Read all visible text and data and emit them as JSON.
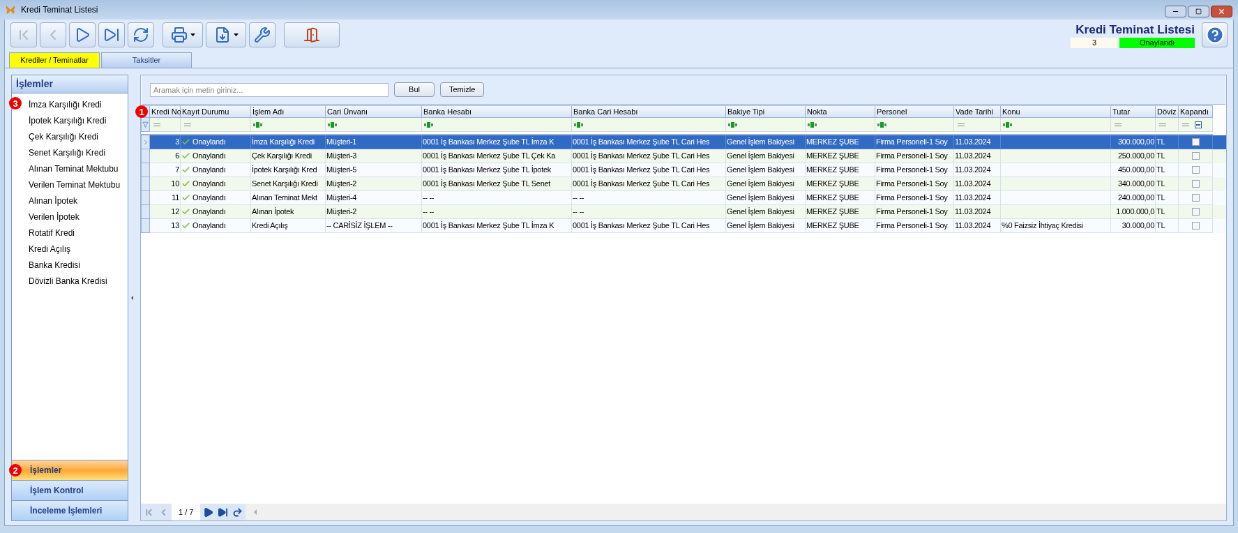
{
  "window": {
    "title": "Kredi Teminat Listesi"
  },
  "toolbar": [
    {
      "kind": "first",
      "disabled": true
    },
    {
      "kind": "prev",
      "disabled": true
    },
    {
      "kind": "next",
      "disabled": false
    },
    {
      "kind": "last",
      "disabled": false
    },
    {
      "kind": "refresh",
      "disabled": false
    },
    {
      "kind": "print",
      "disabled": false
    },
    {
      "kind": "export",
      "disabled": false
    },
    {
      "kind": "tools",
      "disabled": false
    },
    {
      "kind": "exit",
      "disabled": false
    }
  ],
  "header": {
    "title": "Kredi Teminat Listesi",
    "record_no": "3",
    "status": "Onaylandı"
  },
  "tabs": [
    {
      "label": "Krediler / Teminatlar",
      "selected": true
    },
    {
      "label": "Taksitler",
      "selected": false
    }
  ],
  "sidebar": {
    "title": "İşlemler",
    "marker": "3",
    "items": [
      "İmza Karşılığı Kredi",
      "İpotek Karşılığı Kredi",
      "Çek Karşılığı Kredi",
      "Senet Karşılığı Kredi",
      "Alınan Teminat Mektubu",
      "Verilen Teminat Mektubu",
      "Alınan İpotek",
      "Verilen İpotek",
      "Rotatif Kredi",
      "Kredi Açılış",
      "Banka Kredisi",
      "Dövizli Banka Kredisi"
    ],
    "sections": [
      {
        "label": "İşlemler",
        "selected": true,
        "marker": "2"
      },
      {
        "label": "İşlem Kontrol",
        "selected": false
      },
      {
        "label": "İnceleme İşlemleri",
        "selected": false
      }
    ]
  },
  "search": {
    "placeholder": "Aramak için metin giriniz...",
    "buttons": [
      "Bul",
      "Temizle"
    ]
  },
  "table": {
    "marker": "1",
    "columns": [
      {
        "label": "Kredi No",
        "kind": "equals"
      },
      {
        "label": "Kayıt Durumu",
        "kind": "equals"
      },
      {
        "label": "İşlem Adı",
        "kind": "text"
      },
      {
        "label": "Cari Ünvanı",
        "kind": "text"
      },
      {
        "label": "Banka Hesabı",
        "kind": "text"
      },
      {
        "label": "Banka Cari Hesabı",
        "kind": "text"
      },
      {
        "label": "Bakiye Tipi",
        "kind": "text"
      },
      {
        "label": "Nokta",
        "kind": "text"
      },
      {
        "label": "Personel",
        "kind": "text"
      },
      {
        "label": "Vade Tarihi",
        "kind": "equals"
      },
      {
        "label": "Konu",
        "kind": "text"
      },
      {
        "label": "Tutar",
        "kind": "equals"
      },
      {
        "label": "Döviz",
        "kind": "equals"
      },
      {
        "label": "Kapandı",
        "kind": "check"
      }
    ],
    "rows": [
      {
        "selected": true,
        "closed": false,
        "cells": [
          "3",
          "Onaylandı",
          "İmza Karşılığı Kredi",
          "Müşteri-1",
          "0001 İş Bankası Merkez Şube TL İmza K",
          "0001 İş Bankası Merkez Şube TL Cari Hes",
          "Genel İşlem Bakiyesi",
          "MERKEZ ŞUBE",
          "Firma Personeli-1 Soy",
          "11.03.2024",
          "",
          "300.000,00",
          "TL"
        ]
      },
      {
        "selected": false,
        "closed": false,
        "cells": [
          "6",
          "Onaylandı",
          "Çek Karşılığı Kredi",
          "Müşteri-3",
          "0001 İş Bankası Merkez Şube TL Çek Ka",
          "0001 İş Bankası Merkez Şube TL Cari Hes",
          "Genel İşlem Bakiyesi",
          "MERKEZ ŞUBE",
          "Firma Personeli-1 Soy",
          "11.03.2024",
          "",
          "250.000,00",
          "TL"
        ]
      },
      {
        "selected": false,
        "closed": false,
        "cells": [
          "7",
          "Onaylandı",
          "İpotek Karşılığı Kred",
          "Müşteri-5",
          "0001 İş Bankası Merkez Şube TL İpotek",
          "0001 İş Bankası Merkez Şube TL Cari Hes",
          "Genel İşlem Bakiyesi",
          "MERKEZ ŞUBE",
          "Firma Personeli-1 Soy",
          "11.03.2024",
          "",
          "450.000,00",
          "TL"
        ]
      },
      {
        "selected": false,
        "closed": false,
        "cells": [
          "10",
          "Onaylandı",
          "Senet Karşılığı Kredi",
          "Müşteri-2",
          "0001 İş Bankası Merkez Şube TL Senet",
          "0001 İş Bankası Merkez Şube TL Cari Hes",
          "Genel İşlem Bakiyesi",
          "MERKEZ ŞUBE",
          "Firma Personeli-1 Soy",
          "11.03.2024",
          "",
          "340.000,00",
          "TL"
        ]
      },
      {
        "selected": false,
        "closed": false,
        "cells": [
          "11",
          "Onaylandı",
          "Alınan Teminat Mekt",
          "Müşteri-4",
          "-- --",
          "-- --",
          "Genel İşlem Bakiyesi",
          "MERKEZ ŞUBE",
          "Firma Personeli-1 Soy",
          "11.03.2024",
          "",
          "240.000,00",
          "TL"
        ]
      },
      {
        "selected": false,
        "closed": false,
        "cells": [
          "12",
          "Onaylandı",
          "Alınan İpotek",
          "Müşteri-2",
          "-- --",
          "-- --",
          "Genel İşlem Bakiyesi",
          "MERKEZ ŞUBE",
          "Firma Personeli-1 Soy",
          "11.03.2024",
          "",
          "1.000.000,0",
          "TL"
        ]
      },
      {
        "selected": false,
        "closed": false,
        "cells": [
          "13",
          "Onaylandı",
          "Kredi Açılış",
          "-- CARİSİZ İŞLEM --",
          "0001 İş Bankası Merkez Şube TL İmza K",
          "0001 İş Bankası Merkez Şube TL Cari Hes",
          "Genel İşlem Bakiyesi",
          "MERKEZ ŞUBE",
          "Firma Personeli-1 Soy",
          "11.03.2024",
          "%0 Faizsiz İhtiyaç Kredisi",
          "30.000,00",
          "TL"
        ]
      }
    ]
  },
  "pager": {
    "page": "1 / 7",
    "buttons": [
      {
        "kind": "first",
        "disabled": true
      },
      {
        "kind": "prev",
        "disabled": true
      },
      {
        "kind": "next",
        "disabled": false
      },
      {
        "kind": "last",
        "disabled": false
      },
      {
        "kind": "refresh",
        "disabled": false
      }
    ]
  }
}
